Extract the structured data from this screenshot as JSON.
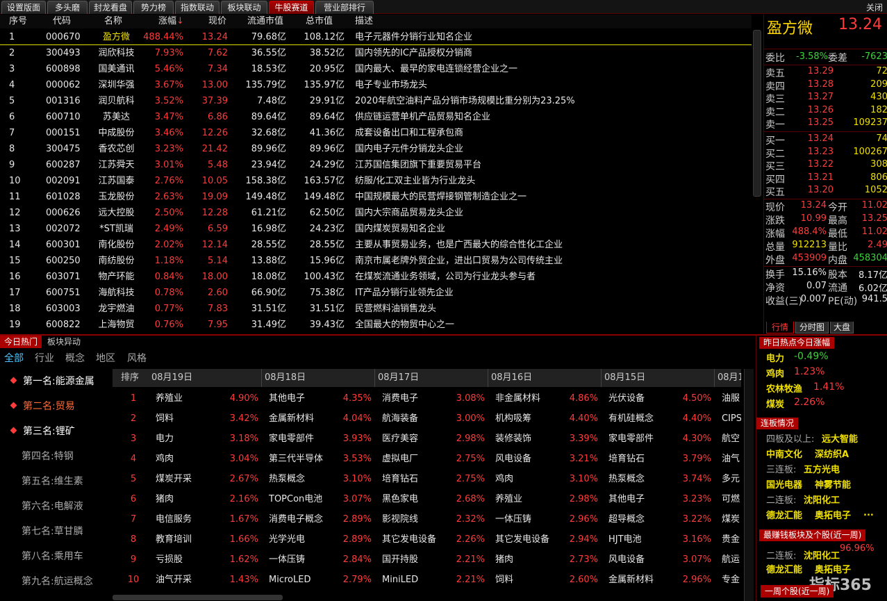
{
  "top_tabs": [
    "设置版面",
    "多头磨",
    "封龙看盘",
    "势力榜",
    "指数联动",
    "板块联动",
    "牛股赛道",
    "营业部排行"
  ],
  "close_label": "关闭",
  "list_headers": {
    "idx": "序号",
    "code": "代码",
    "name": "名称",
    "chg": "涨幅",
    "sort_arrow": "↓",
    "price": "现价",
    "float_cap": "流通市值",
    "total_cap": "总市值",
    "desc": "描述"
  },
  "stocks": [
    {
      "idx": "1",
      "code": "000670",
      "name": "盈方微",
      "chg": "488.44%",
      "price": "13.24",
      "float_cap": "79.68亿",
      "total_cap": "108.12亿",
      "desc": "电子元器件分销行业知名企业"
    },
    {
      "idx": "2",
      "code": "300493",
      "name": "润欣科技",
      "chg": "7.93%",
      "price": "7.62",
      "float_cap": "36.55亿",
      "total_cap": "38.52亿",
      "desc": "国内领先的IC产品授权分销商"
    },
    {
      "idx": "3",
      "code": "600898",
      "name": "国美通讯",
      "chg": "5.46%",
      "price": "7.34",
      "float_cap": "18.53亿",
      "total_cap": "20.95亿",
      "desc": "国内最大、最早的家电连锁经营企业之一"
    },
    {
      "idx": "4",
      "code": "000062",
      "name": "深圳华强",
      "chg": "3.67%",
      "price": "13.00",
      "float_cap": "135.79亿",
      "total_cap": "135.97亿",
      "desc": "电子专业市场龙头"
    },
    {
      "idx": "5",
      "code": "001316",
      "name": "润贝航科",
      "chg": "3.52%",
      "price": "37.39",
      "float_cap": "7.48亿",
      "total_cap": "29.91亿",
      "desc": "2020年航空油料产品分销市场规模比重分别为23.25%"
    },
    {
      "idx": "6",
      "code": "600710",
      "name": "苏美达",
      "chg": "3.47%",
      "price": "6.86",
      "float_cap": "89.64亿",
      "total_cap": "89.64亿",
      "desc": "供应链运营单机产品贸易知名企业"
    },
    {
      "idx": "7",
      "code": "000151",
      "name": "中成股份",
      "chg": "3.46%",
      "price": "12.26",
      "float_cap": "32.68亿",
      "total_cap": "41.36亿",
      "desc": "成套设备出口和工程承包商"
    },
    {
      "idx": "8",
      "code": "300475",
      "name": "香农芯创",
      "chg": "3.23%",
      "price": "21.42",
      "float_cap": "89.96亿",
      "total_cap": "89.96亿",
      "desc": "国内电子元件分销龙头企业"
    },
    {
      "idx": "9",
      "code": "600287",
      "name": "江苏舜天",
      "chg": "3.01%",
      "price": "5.48",
      "float_cap": "23.94亿",
      "total_cap": "24.29亿",
      "desc": "江苏国信集团旗下重要贸易平台"
    },
    {
      "idx": "10",
      "code": "002091",
      "name": "江苏国泰",
      "chg": "2.76%",
      "price": "10.05",
      "float_cap": "158.38亿",
      "total_cap": "163.57亿",
      "desc": "纺服/化工双主业皆为行业龙头"
    },
    {
      "idx": "11",
      "code": "601028",
      "name": "玉龙股份",
      "chg": "2.63%",
      "price": "19.09",
      "float_cap": "149.48亿",
      "total_cap": "149.48亿",
      "desc": "中国规模最大的民营焊接钢管制造企业之一"
    },
    {
      "idx": "12",
      "code": "000626",
      "name": "远大控股",
      "chg": "2.50%",
      "price": "12.28",
      "float_cap": "61.21亿",
      "total_cap": "62.50亿",
      "desc": "国内大宗商品贸易龙头企业"
    },
    {
      "idx": "13",
      "code": "002072",
      "name": "*ST凯瑞",
      "chg": "2.49%",
      "price": "6.59",
      "float_cap": "16.98亿",
      "total_cap": "24.23亿",
      "desc": "国内煤炭贸易知名企业"
    },
    {
      "idx": "14",
      "code": "600301",
      "name": "南化股份",
      "chg": "2.02%",
      "price": "12.14",
      "float_cap": "28.55亿",
      "total_cap": "28.55亿",
      "desc": "主要从事贸易业务，也是广西最大的综合性化工企业"
    },
    {
      "idx": "15",
      "code": "600250",
      "name": "南纺股份",
      "chg": "1.18%",
      "price": "5.14",
      "float_cap": "13.88亿",
      "total_cap": "15.96亿",
      "desc": "南京市属老牌外贸企业，进出口贸易为公司传统主业"
    },
    {
      "idx": "16",
      "code": "603071",
      "name": "物产环能",
      "chg": "0.84%",
      "price": "18.00",
      "float_cap": "18.08亿",
      "total_cap": "100.43亿",
      "desc": "在煤炭流通业务领域，公司为行业龙头参与者"
    },
    {
      "idx": "17",
      "code": "600751",
      "name": "海航科技",
      "chg": "0.78%",
      "price": "2.60",
      "float_cap": "66.90亿",
      "total_cap": "75.38亿",
      "desc": "IT产品分销行业领先企业"
    },
    {
      "idx": "18",
      "code": "603003",
      "name": "龙宇燃油",
      "chg": "0.77%",
      "price": "7.83",
      "float_cap": "31.51亿",
      "total_cap": "31.51亿",
      "desc": "民营燃料油销售龙头"
    },
    {
      "idx": "19",
      "code": "600822",
      "name": "上海物贸",
      "chg": "0.76%",
      "price": "7.95",
      "float_cap": "31.49亿",
      "total_cap": "39.43亿",
      "desc": "全国最大的物贸中心之一"
    }
  ],
  "quote": {
    "name": "盈方微",
    "price": "13.24",
    "price_trunc": "4",
    "weibi_label": "委比",
    "weibi": "-3.58%",
    "weicha_label": "委差",
    "weicha": "-7623",
    "asks": [
      {
        "label": "卖五",
        "price": "13.29",
        "vol": "72"
      },
      {
        "label": "卖四",
        "price": "13.28",
        "vol": "209"
      },
      {
        "label": "卖三",
        "price": "13.27",
        "vol": "430"
      },
      {
        "label": "卖二",
        "price": "13.26",
        "vol": "182"
      },
      {
        "label": "卖一",
        "price": "13.25",
        "vol": "109237"
      }
    ],
    "bids": [
      {
        "label": "买一",
        "price": "13.24",
        "vol": "74"
      },
      {
        "label": "买二",
        "price": "13.23",
        "vol": "100267"
      },
      {
        "label": "买三",
        "price": "13.22",
        "vol": "308"
      },
      {
        "label": "买四",
        "price": "13.21",
        "vol": "806"
      },
      {
        "label": "买五",
        "price": "13.20",
        "vol": "1052"
      }
    ],
    "stats1": [
      {
        "l1": "现价",
        "v1": "13.24",
        "l2": "今开",
        "v2": "11.02"
      },
      {
        "l1": "涨跌",
        "v1": "10.99",
        "l2": "最高",
        "v2": "13.25"
      },
      {
        "l1": "涨幅",
        "v1": "488.4%",
        "l2": "最低",
        "v2": "11.02"
      },
      {
        "l1": "总量",
        "v1": "912213",
        "l2": "量比",
        "v2": "2.49"
      },
      {
        "l1": "外盘",
        "v1": "453909",
        "l2": "内盘",
        "v2": "458304"
      }
    ],
    "stats2": [
      {
        "l1": "换手",
        "v1": "15.16%",
        "l2": "股本",
        "v2": "8.17亿"
      },
      {
        "l1": "净资",
        "v1": "0.07",
        "l2": "流通",
        "v2": "6.02亿"
      },
      {
        "l1": "收益(三)",
        "v1": "0.007",
        "l2": "PE(动)",
        "v2": "941.5"
      }
    ],
    "tabs": [
      "行情",
      "分时图",
      "大盘"
    ]
  },
  "hot": {
    "subtabs": [
      "今日热门",
      "板块异动"
    ],
    "categories": [
      "全部",
      "行业",
      "概念",
      "地区",
      "风格"
    ],
    "ranks": [
      "第一名:能源金属",
      "第二名:贸易",
      "第三名:锂矿",
      "第四名:特钢",
      "第五名:维生素",
      "第六名:电解液",
      "第七名:草甘膦",
      "第八名:乘用车",
      "第九名:航运概念"
    ],
    "grid_rank_label": "排序",
    "dates": [
      "08月19日",
      "08月18日",
      "08月17日",
      "08月16日",
      "08月15日",
      "08月1"
    ],
    "rows": [
      {
        "n": "1",
        "cells": [
          [
            "养殖业",
            "4.90%"
          ],
          [
            "其他电子",
            "4.35%"
          ],
          [
            "消费电子",
            "3.08%"
          ],
          [
            "非金属材料",
            "4.86%"
          ],
          [
            "光伏设备",
            "4.50%"
          ],
          [
            "油服",
            ""
          ]
        ]
      },
      {
        "n": "2",
        "cells": [
          [
            "饲料",
            "3.42%"
          ],
          [
            "金属新材料",
            "4.04%"
          ],
          [
            "航海装备",
            "3.00%"
          ],
          [
            "机构吸筹",
            "4.40%"
          ],
          [
            "有机硅概念",
            "4.40%"
          ],
          [
            "CIPS",
            ""
          ]
        ]
      },
      {
        "n": "3",
        "cells": [
          [
            "电力",
            "3.18%"
          ],
          [
            "家电零部件",
            "3.93%"
          ],
          [
            "医疗美容",
            "2.98%"
          ],
          [
            "装修装饰",
            "3.39%"
          ],
          [
            "家电零部件",
            "4.30%"
          ],
          [
            "航空",
            ""
          ]
        ]
      },
      {
        "n": "4",
        "cells": [
          [
            "鸡肉",
            "3.04%"
          ],
          [
            "第三代半导体",
            "3.53%"
          ],
          [
            "虚拟电厂",
            "2.75%"
          ],
          [
            "风电设备",
            "3.21%"
          ],
          [
            "培育钻石",
            "3.79%"
          ],
          [
            "油气",
            ""
          ]
        ]
      },
      {
        "n": "5",
        "cells": [
          [
            "煤炭开采",
            "2.67%"
          ],
          [
            "热泵概念",
            "3.10%"
          ],
          [
            "培育钻石",
            "2.75%"
          ],
          [
            "鸡肉",
            "3.10%"
          ],
          [
            "热泵概念",
            "3.74%"
          ],
          [
            "多元",
            ""
          ]
        ]
      },
      {
        "n": "6",
        "cells": [
          [
            "猪肉",
            "2.16%"
          ],
          [
            "TOPCon电池",
            "3.07%"
          ],
          [
            "黑色家电",
            "2.68%"
          ],
          [
            "养殖业",
            "2.98%"
          ],
          [
            "其他电子",
            "3.23%"
          ],
          [
            "可燃",
            ""
          ]
        ]
      },
      {
        "n": "7",
        "cells": [
          [
            "电信服务",
            "1.67%"
          ],
          [
            "消费电子概念",
            "2.89%"
          ],
          [
            "影视院线",
            "2.32%"
          ],
          [
            "一体压铸",
            "2.96%"
          ],
          [
            "超导概念",
            "3.22%"
          ],
          [
            "煤炭",
            ""
          ]
        ]
      },
      {
        "n": "8",
        "cells": [
          [
            "教育培训",
            "1.66%"
          ],
          [
            "光学光电",
            "2.89%"
          ],
          [
            "其它发电设备",
            "2.26%"
          ],
          [
            "其它发电设备",
            "2.94%"
          ],
          [
            "HJT电池",
            "3.16%"
          ],
          [
            "贵金",
            ""
          ]
        ]
      },
      {
        "n": "9",
        "cells": [
          [
            "亏损股",
            "1.62%"
          ],
          [
            "一体压铸",
            "2.84%"
          ],
          [
            "国开持股",
            "2.21%"
          ],
          [
            "猪肉",
            "2.73%"
          ],
          [
            "风电设备",
            "3.07%"
          ],
          [
            "航运",
            ""
          ]
        ]
      },
      {
        "n": "10",
        "cells": [
          [
            "油气开采",
            "1.43%"
          ],
          [
            "MicroLED",
            "2.79%"
          ],
          [
            "MiniLED",
            "2.21%"
          ],
          [
            "饲料",
            "2.60%"
          ],
          [
            "金属新材料",
            "2.96%"
          ],
          [
            "专金",
            ""
          ]
        ]
      }
    ]
  },
  "side": {
    "hot_title": "昨日热点今日涨幅",
    "hot_items": [
      [
        "电力",
        "-0.49%"
      ],
      [
        "鸡肉",
        "1.23%"
      ],
      [
        "农林牧渔",
        "1.41%"
      ],
      [
        "煤炭",
        "2.26%"
      ]
    ],
    "limit_title": "连板情况",
    "limit_rows": [
      {
        "label": "四板及以上:",
        "stocks": [
          "远大智能"
        ]
      },
      {
        "label": "",
        "stocks": [
          "中南文化",
          "深纺织A"
        ]
      },
      {
        "label": "三连板:",
        "stocks": [
          "五方光电"
        ]
      },
      {
        "label": "",
        "stocks": [
          "国光电器",
          "神雾节能"
        ]
      },
      {
        "label": "二连板:",
        "stocks": [
          "沈阳化工"
        ]
      },
      {
        "label": "",
        "stocks": [
          "德龙汇能",
          "奥拓电子",
          "..."
        ]
      }
    ],
    "earn_title": "最赚钱板块及个股(近一周)",
    "earn_pct": "96.96%",
    "earn_rows": [
      {
        "label": "二连板:",
        "stocks": [
          "沈阳化工"
        ]
      },
      {
        "label": "",
        "stocks": [
          "德龙汇能",
          "奥拓电子"
        ]
      }
    ],
    "bottom_title": "一周个股(近一周)",
    "logo": "指标365"
  },
  "colors": {
    "up": "#ff3b3b",
    "down": "#3ad53a",
    "accent": "#a00000",
    "name": "#ffd700"
  }
}
